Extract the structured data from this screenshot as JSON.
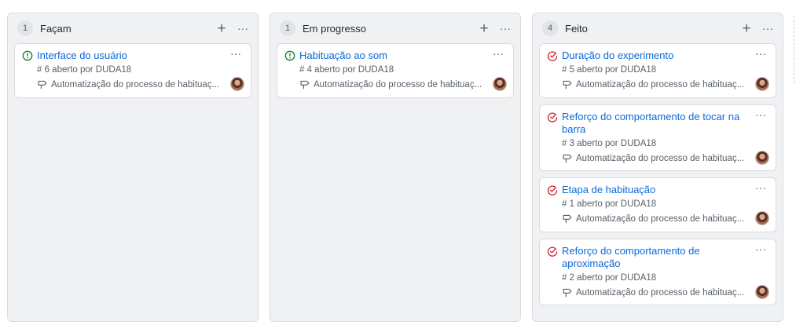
{
  "columns": [
    {
      "count": "1",
      "title": "Façam",
      "cards": [
        {
          "status": "open",
          "title": "Interface do usuário",
          "meta": "# 6 aberto por DUDA18",
          "project": "Automatização do processo de habituaç..."
        }
      ]
    },
    {
      "count": "1",
      "title": "Em progresso",
      "cards": [
        {
          "status": "open",
          "title": "Habituação ao som",
          "meta": "# 4 aberto por DUDA18",
          "project": "Automatização do processo de habituaç..."
        }
      ]
    },
    {
      "count": "4",
      "title": "Feito",
      "cards": [
        {
          "status": "closed",
          "title": "Duração do experimento",
          "meta": "# 5 aberto por DUDA18",
          "project": "Automatização do processo de habituaç..."
        },
        {
          "status": "closed",
          "title": "Reforço do comportamento de tocar na barra",
          "meta": "# 3 aberto por DUDA18",
          "project": "Automatização do processo de habituaç..."
        },
        {
          "status": "closed",
          "title": "Etapa de habituação",
          "meta": "# 1 aberto por DUDA18",
          "project": "Automatização do processo de habituaç..."
        },
        {
          "status": "closed",
          "title": "Reforço do comportamento de aproximação",
          "meta": "# 2 aberto por DUDA18",
          "project": "Automatização do processo de habituaç..."
        }
      ]
    }
  ],
  "icons": {
    "add": "+",
    "menu": "···",
    "open_issue": "issue-opened-icon",
    "closed_issue": "issue-closed-icon",
    "project": "project-pin-icon"
  },
  "colors": {
    "link": "#0969da",
    "open": "#1a7f37",
    "closed": "#cf222e",
    "column_bg": "#f0f1f3"
  }
}
